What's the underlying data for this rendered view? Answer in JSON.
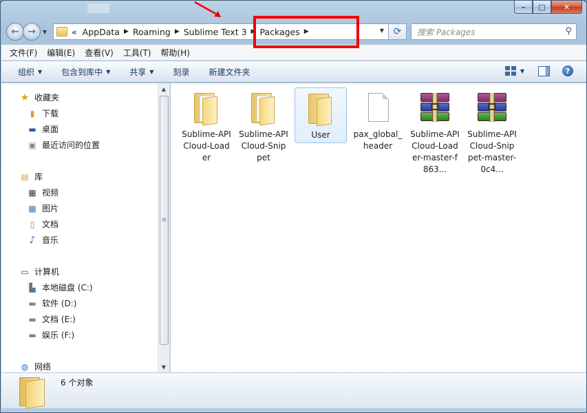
{
  "window": {
    "caption_buttons": {
      "minimize": "–",
      "maximize": "□",
      "close": "✕"
    }
  },
  "address": {
    "prefix": "«",
    "breadcrumbs": [
      "AppData",
      "Roaming",
      "Sublime Text 3",
      "Packages"
    ]
  },
  "search": {
    "placeholder": "搜索 Packages"
  },
  "menu": [
    "文件(F)",
    "编辑(E)",
    "查看(V)",
    "工具(T)",
    "帮助(H)"
  ],
  "toolbar": {
    "organize": "组织",
    "include_in_library": "包含到库中",
    "share": "共享",
    "burn": "刻录",
    "new_folder": "新建文件夹"
  },
  "navigation": {
    "favorites": {
      "label": "收藏夹",
      "items": [
        "下载",
        "桌面",
        "最近访问的位置"
      ]
    },
    "libraries": {
      "label": "库",
      "items": [
        "视频",
        "图片",
        "文档",
        "音乐"
      ]
    },
    "computer": {
      "label": "计算机",
      "items": [
        "本地磁盘 (C:)",
        "软件 (D:)",
        "文档 (E:)",
        "娱乐 (F:)"
      ]
    },
    "network": {
      "label": "网络"
    }
  },
  "files": [
    {
      "label": "Sublime-APICloud-Loader",
      "type": "folder",
      "selected": false
    },
    {
      "label": "Sublime-APICloud-Snippet",
      "type": "folder",
      "selected": false
    },
    {
      "label": "User",
      "type": "folder",
      "selected": true
    },
    {
      "label": "pax_global_header",
      "type": "file",
      "selected": false
    },
    {
      "label": "Sublime-APICloud-Loader-master-f863...",
      "type": "rar",
      "selected": false
    },
    {
      "label": "Sublime-APICloud-Snippet-master-0c4...",
      "type": "rar",
      "selected": false
    }
  ],
  "status": {
    "count_text": "6 个对象"
  },
  "colors": {
    "annotation": "#f20000",
    "chrome": "#b5cde2"
  }
}
